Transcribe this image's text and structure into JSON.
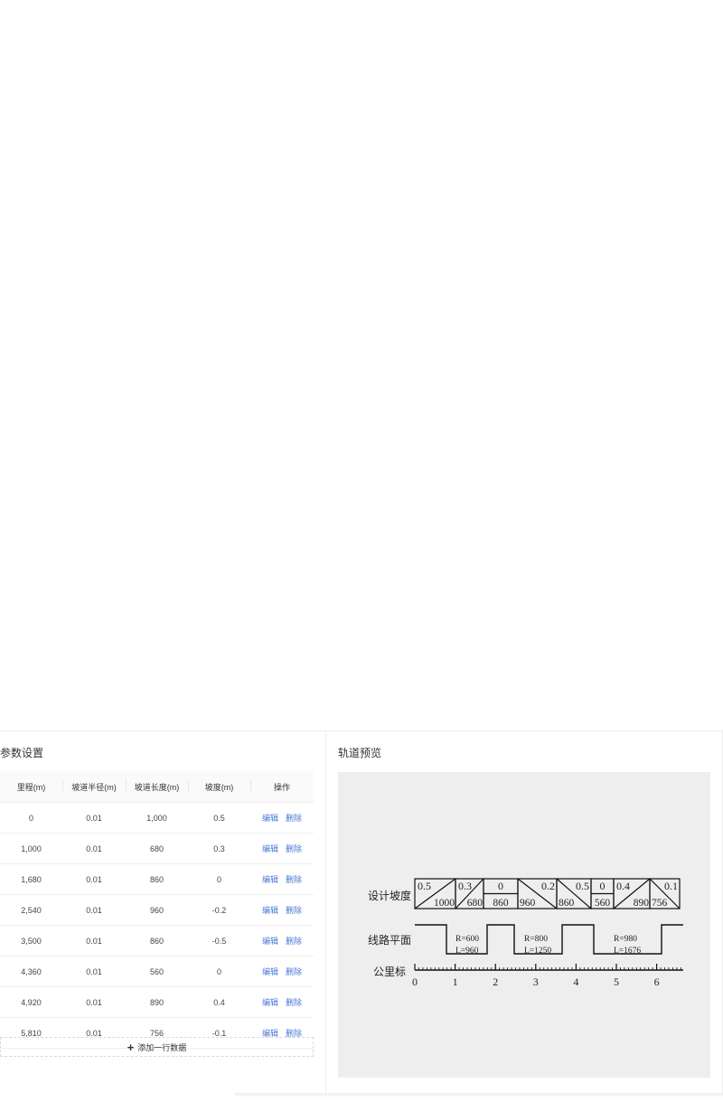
{
  "params": {
    "title": "参数设置",
    "columns": [
      "里程(m)",
      "坡道半径(m)",
      "坡道长度(m)",
      "坡度(m)",
      "操作"
    ],
    "rows": [
      [
        "0",
        "0.01",
        "1,000",
        "0.5"
      ],
      [
        "1,000",
        "0.01",
        "680",
        "0.3"
      ],
      [
        "1,680",
        "0.01",
        "860",
        "0"
      ],
      [
        "2,540",
        "0.01",
        "960",
        "-0.2"
      ],
      [
        "3,500",
        "0.01",
        "860",
        "-0.5"
      ],
      [
        "4,360",
        "0.01",
        "560",
        "0"
      ],
      [
        "4,920",
        "0.01",
        "890",
        "0.4"
      ],
      [
        "5,810",
        "0.01",
        "756",
        "-0.1"
      ]
    ],
    "edit_label": "编辑",
    "delete_label": "删除",
    "add_label": "添加一行数据",
    "add_icon": "plus-icon"
  },
  "preview": {
    "title": "轨道预览",
    "slope_label": "设计坡度",
    "plan_label": "线路平面",
    "km_label": "公里标",
    "slopes": [
      {
        "grade": "0.5",
        "length": "1000"
      },
      {
        "grade": "0.3",
        "length": "680"
      },
      {
        "grade": "0",
        "length": "860"
      },
      {
        "grade": "0.2",
        "length": "960"
      },
      {
        "grade": "0.5",
        "length": "860"
      },
      {
        "grade": "0",
        "length": "560"
      },
      {
        "grade": "0.4",
        "length": "890"
      },
      {
        "grade": "0.1",
        "length": "756"
      }
    ],
    "curves": [
      {
        "r": "R=600",
        "l": "L=960"
      },
      {
        "r": "R=800",
        "l": "L=1250"
      },
      {
        "r": "R=980",
        "l": "L=1676"
      }
    ],
    "km_ticks": [
      "0",
      "1",
      "2",
      "3",
      "4",
      "5",
      "6"
    ]
  },
  "colors": {
    "link": "#4a78d8",
    "preview_bg": "#eeeeee"
  }
}
